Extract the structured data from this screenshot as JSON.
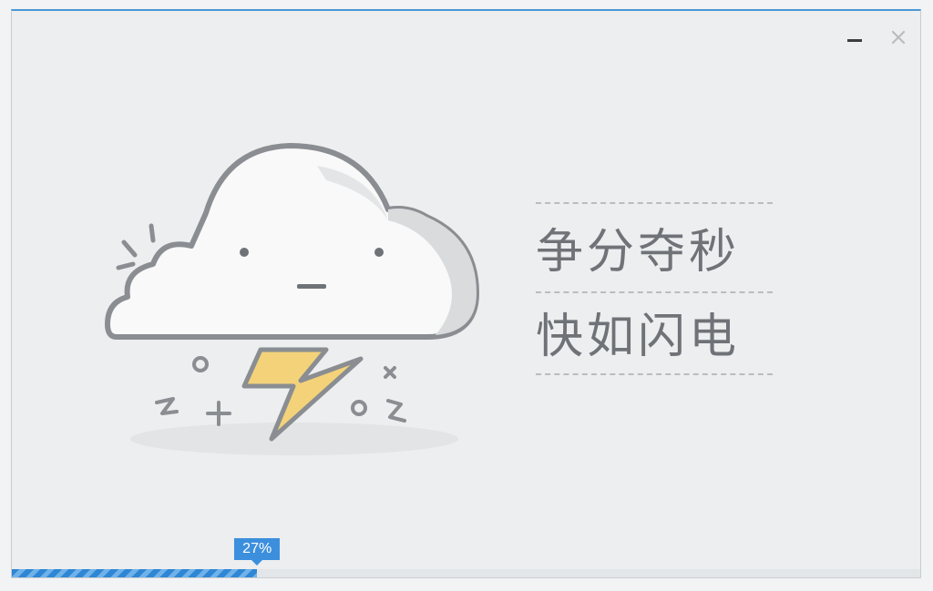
{
  "window": {
    "minimize_icon": "minimize-icon",
    "close_icon": "close-icon"
  },
  "illustration": {
    "name": "cloud-lightning-illustration",
    "accent_color": "#f3d27a",
    "line_color": "#8a8d91"
  },
  "slogan": {
    "line1": "争分夺秒",
    "line2": "快如闪电"
  },
  "progress": {
    "percent": 27,
    "label": "27%",
    "color": "#2f86d4"
  }
}
